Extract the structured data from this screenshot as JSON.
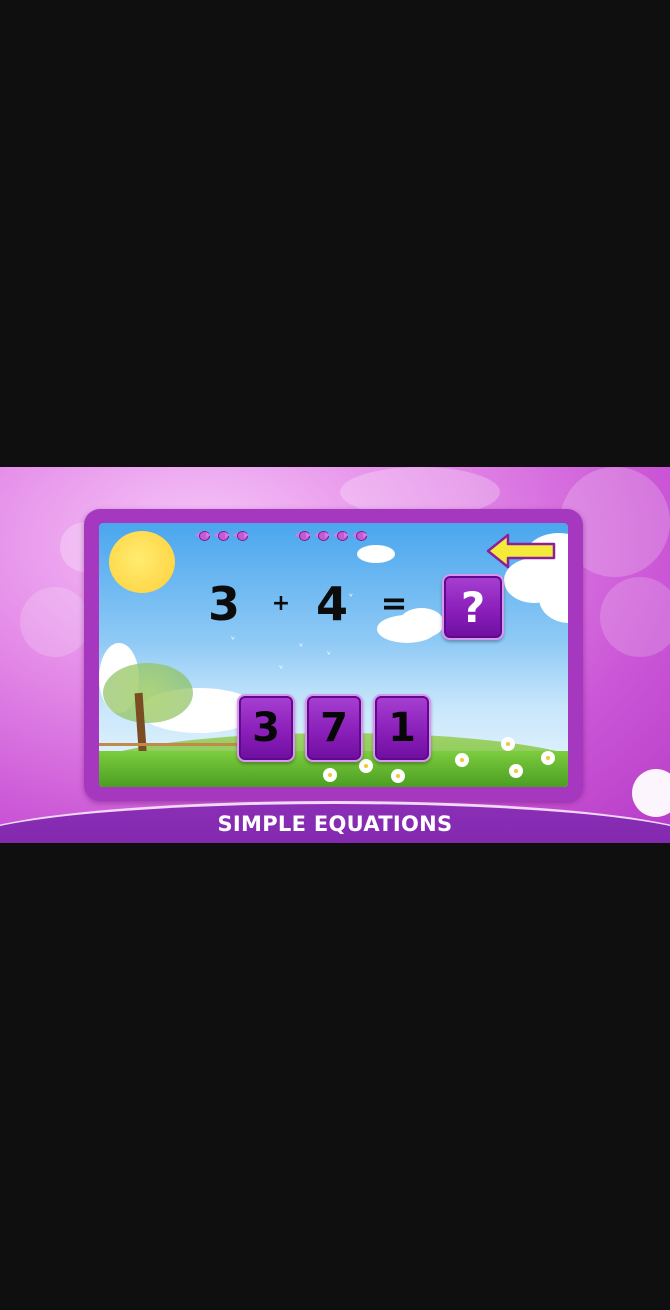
{
  "equation": {
    "operand1": "3",
    "operator": "+",
    "operand2": "4",
    "equals": "=",
    "answer_placeholder": "?"
  },
  "choices": [
    "3",
    "7",
    "1"
  ],
  "banner": {
    "title": "SIMPLE EQUATIONS"
  },
  "progress": {
    "group1_count": 3,
    "group2_count": 4
  },
  "colors": {
    "tile_purple": "#8b1fba",
    "frame_purple": "#a638c0",
    "arrow_yellow": "#f4ea3a",
    "sky_blue": "#4aa6ee",
    "banner_purple": "#7a27a8"
  },
  "icons": {
    "back": "back-arrow-icon",
    "candy": "candy-icon",
    "sun": "sun-icon"
  }
}
